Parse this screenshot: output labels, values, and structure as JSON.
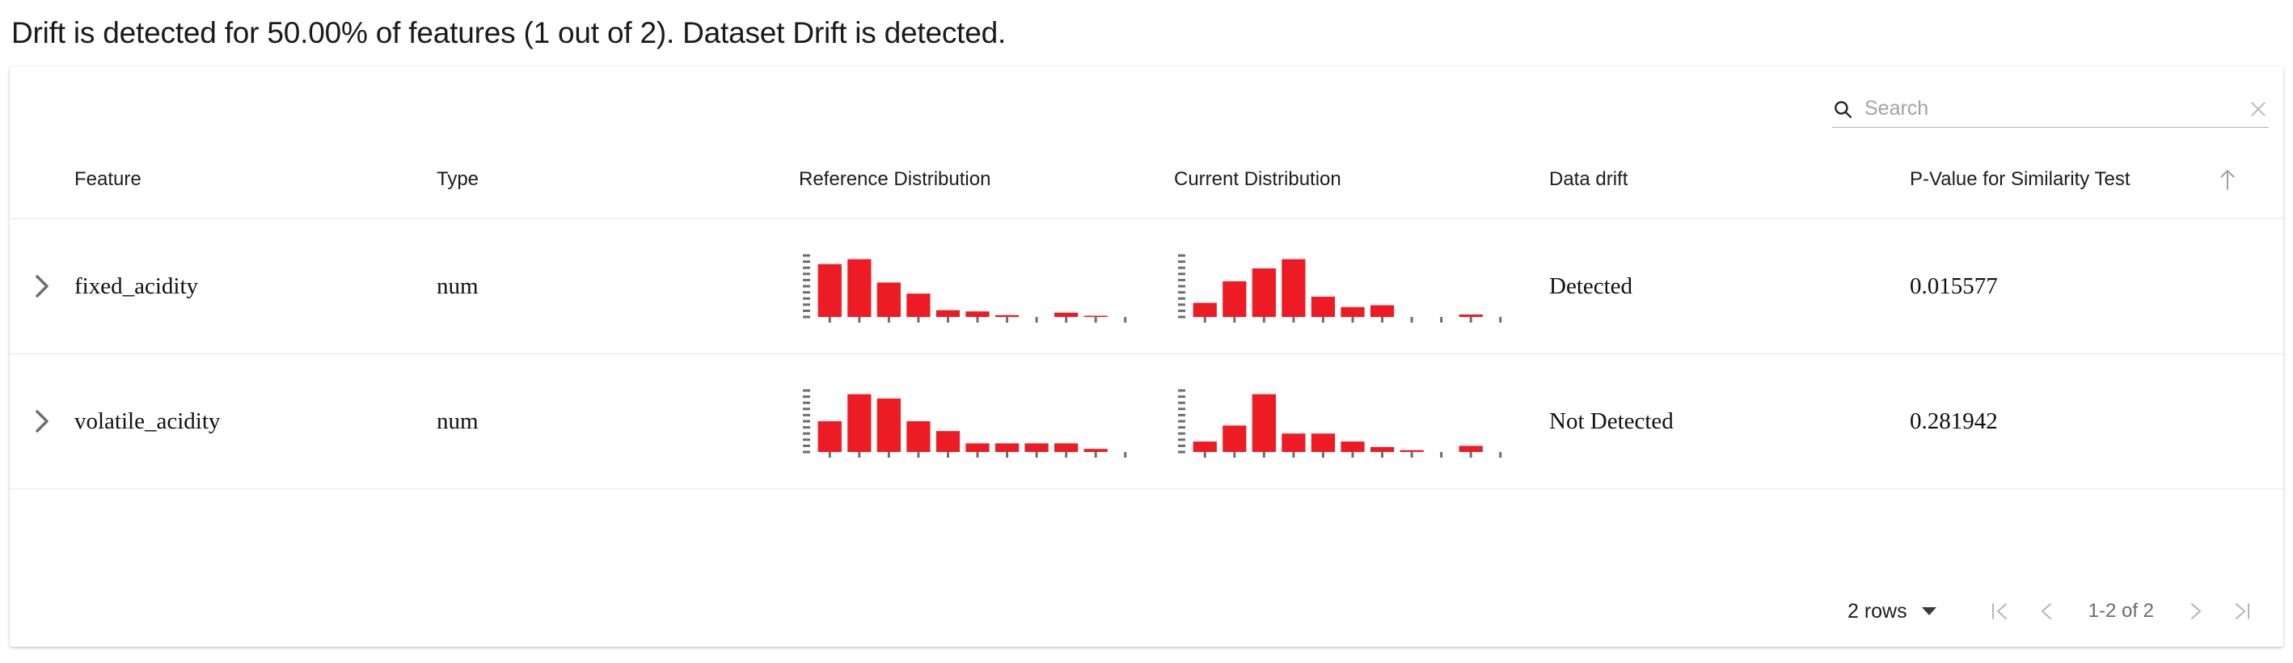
{
  "headline": "Drift is detected for 50.00% of features (1 out of 2). Dataset Drift is detected.",
  "search": {
    "placeholder": "Search",
    "value": "",
    "search_icon": "search-icon",
    "clear_icon": "close-icon"
  },
  "table": {
    "columns": [
      {
        "key": "expand",
        "label": ""
      },
      {
        "key": "feature",
        "label": "Feature"
      },
      {
        "key": "type",
        "label": "Type"
      },
      {
        "key": "reference",
        "label": "Reference Distribution"
      },
      {
        "key": "current",
        "label": "Current Distribution"
      },
      {
        "key": "drift",
        "label": "Data drift"
      },
      {
        "key": "pvalue",
        "label": "P-Value for Similarity Test"
      }
    ],
    "sorted_column": "pvalue",
    "sort_direction": "asc",
    "sort_icon": "arrow-up-icon",
    "expand_icon": "chevron-right-icon",
    "rows": [
      {
        "feature": "fixed_acidity",
        "type": "num",
        "drift": "Detected",
        "pvalue": "0.015577"
      },
      {
        "feature": "volatile_acidity",
        "type": "num",
        "drift": "Not Detected",
        "pvalue": "0.281942"
      }
    ]
  },
  "footer": {
    "rows_per_page_label": "2 rows",
    "rows_per_page_caret": "chevron-down-icon",
    "first_page_icon": "first-page-icon",
    "prev_page_icon": "chevron-left-icon",
    "next_page_icon": "chevron-right-icon",
    "last_page_icon": "last-page-icon",
    "page_info": "1-2 of 2"
  },
  "colors": {
    "bar": "#ED1C24",
    "tick": "#6e6e6e",
    "text": "#101010",
    "muted": "#9e9e9e"
  },
  "chart_data": [
    {
      "id": "fixed_acidity_reference",
      "type": "bar",
      "title": "Reference Distribution",
      "feature": "fixed_acidity",
      "ylim": [
        0,
        1
      ],
      "grid": false,
      "xlabel": "",
      "ylabel": "",
      "values": [
        0.86,
        0.94,
        0.56,
        0.38,
        0.11,
        0.09,
        0.03,
        0.0,
        0.07,
        0.02,
        0.0
      ],
      "axis_ticks_y": 11
    },
    {
      "id": "fixed_acidity_current",
      "type": "bar",
      "title": "Current Distribution",
      "feature": "fixed_acidity",
      "ylim": [
        0,
        1
      ],
      "grid": false,
      "xlabel": "",
      "ylabel": "",
      "values": [
        0.23,
        0.58,
        0.79,
        0.94,
        0.33,
        0.16,
        0.19,
        0.0,
        0.0,
        0.04,
        0.0
      ],
      "axis_ticks_y": 11
    },
    {
      "id": "volatile_acidity_reference",
      "type": "bar",
      "title": "Reference Distribution",
      "feature": "volatile_acidity",
      "ylim": [
        0,
        1
      ],
      "grid": false,
      "xlabel": "",
      "ylabel": "",
      "values": [
        0.5,
        0.94,
        0.87,
        0.5,
        0.34,
        0.14,
        0.14,
        0.14,
        0.14,
        0.05,
        0.0
      ],
      "axis_ticks_y": 11
    },
    {
      "id": "volatile_acidity_current",
      "type": "bar",
      "title": "Current Distribution",
      "feature": "volatile_acidity",
      "ylim": [
        0,
        1
      ],
      "grid": false,
      "xlabel": "",
      "ylabel": "",
      "values": [
        0.17,
        0.43,
        0.94,
        0.3,
        0.3,
        0.17,
        0.08,
        0.03,
        0.0,
        0.1,
        0.0
      ],
      "axis_ticks_y": 11
    }
  ]
}
